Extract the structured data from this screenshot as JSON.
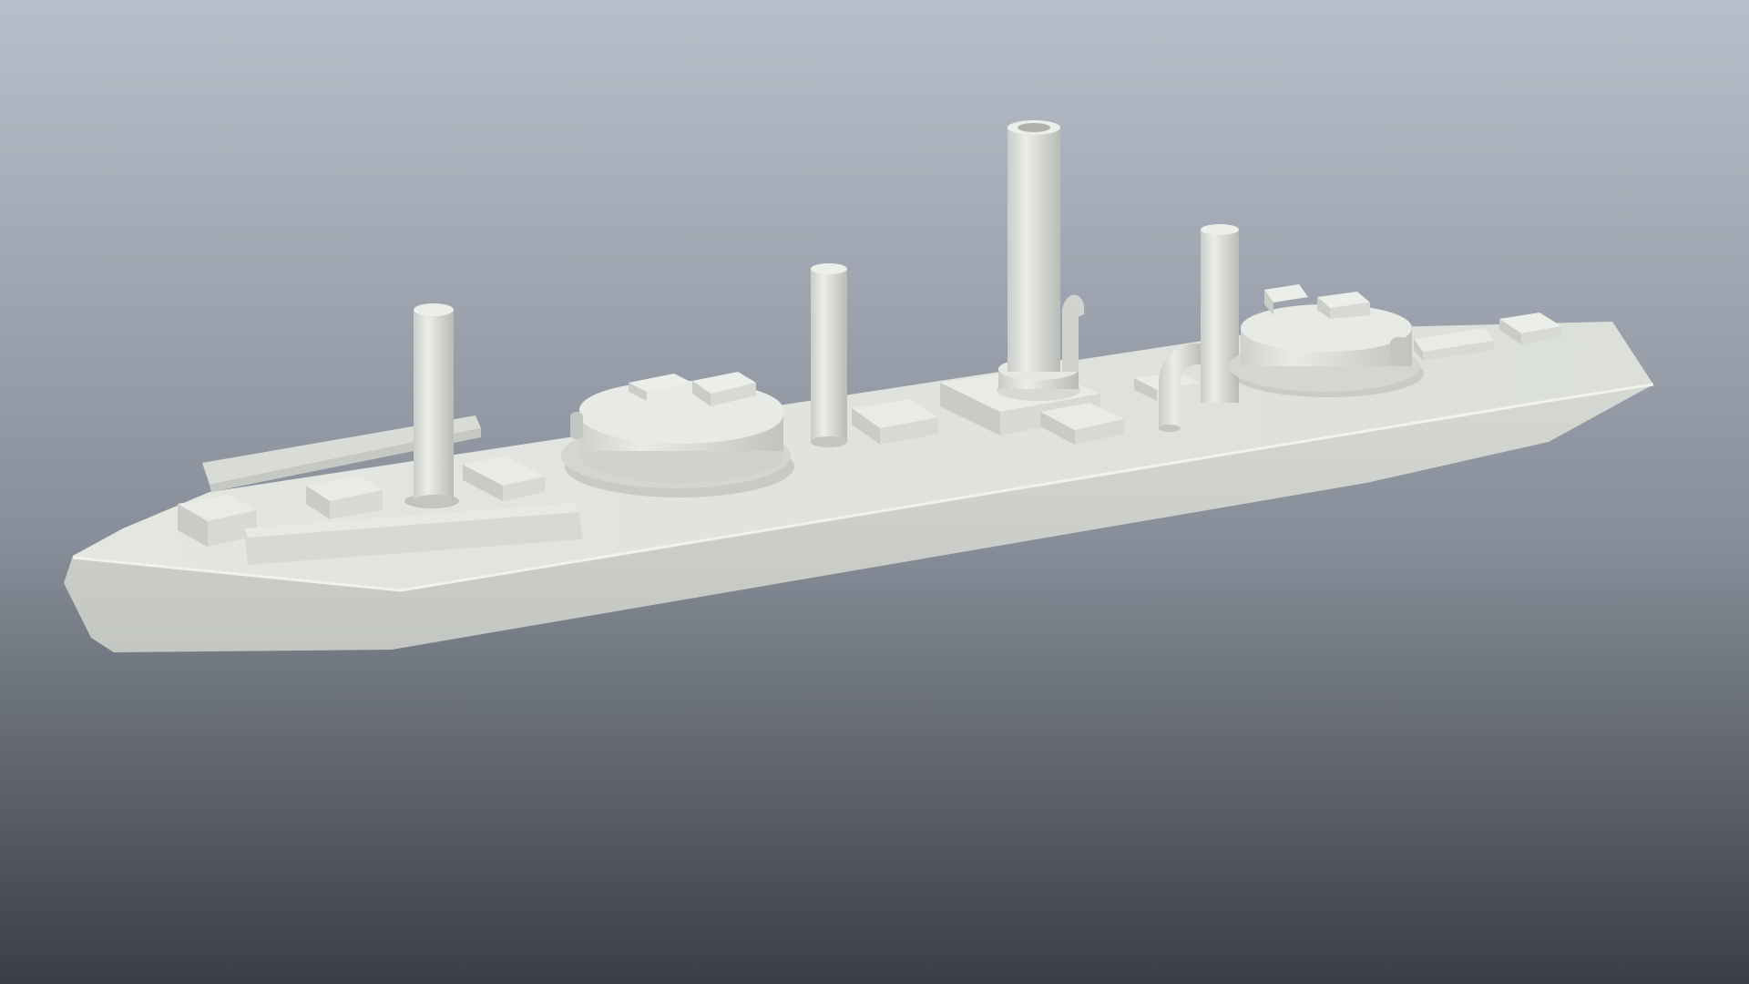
{
  "scene": {
    "subject": "ship-model",
    "colors": {
      "background_top": "#b9bfca",
      "background_mid": "#878e99",
      "background_bottom": "#3a3e46",
      "hull_side": "#d4d7d2",
      "hull_side_dark": "#c2c5c0",
      "deck": "#e3e5e0",
      "deck_shadow": "#cfd2cc",
      "structure_light": "#e8eae5",
      "structure_mid": "#d2d5d0",
      "structure_dark": "#b9bcb7",
      "shadow": "#a9aca7"
    }
  }
}
